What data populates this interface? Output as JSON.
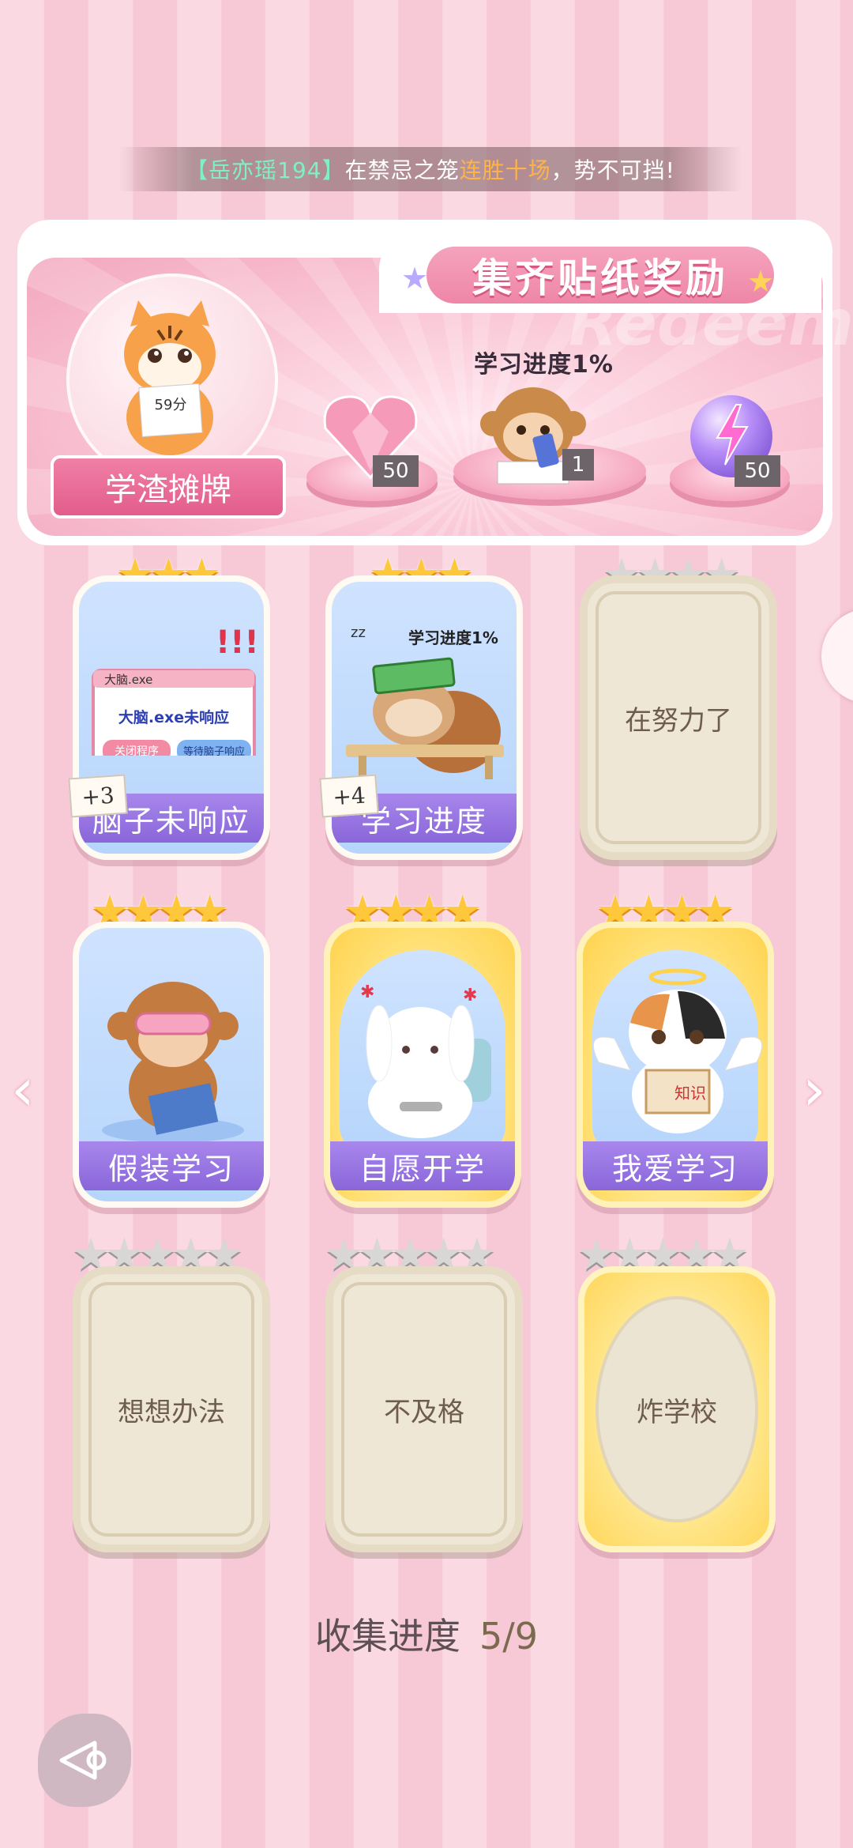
{
  "marquee": {
    "name": "【岳亦瑶194】",
    "text1": "在禁忌之笼",
    "highlight": "连胜十场",
    "text2": "，势不可挡!"
  },
  "banner": {
    "title": "集齐贴纸奖励",
    "watermark": "Redeem",
    "tag": "学渣摊牌",
    "tiger_note": "59分",
    "center_label": "学习进度1%",
    "rewards": [
      {
        "icon": "pink-diamond-heart-icon",
        "qty": "50"
      },
      {
        "icon": "monkey-studying-icon",
        "qty": "1"
      },
      {
        "icon": "purple-lightning-orb-icon",
        "qty": "50"
      }
    ]
  },
  "cards": [
    {
      "label": "脑子未响应",
      "stars": 4,
      "state": "unlocked",
      "extra": "+3",
      "popup_title": "大脑.exe",
      "popup_msg": "大脑.exe未响应",
      "btn1": "关闭程序",
      "btn2": "等待脑子响应"
    },
    {
      "label": "学习进度",
      "stars": 4,
      "state": "unlocked",
      "extra": "+4",
      "note": "学习进度1%",
      "zz": "zz"
    },
    {
      "label": "在努力了",
      "stars": 4,
      "state": "locked"
    },
    {
      "label": "假装学习",
      "stars": 4,
      "state": "unlocked"
    },
    {
      "label": "自愿开学",
      "stars": 4,
      "state": "unlocked-gold"
    },
    {
      "label": "我爱学习",
      "stars": 4,
      "state": "unlocked-gold",
      "book_text": "知识"
    },
    {
      "label": "想想办法",
      "stars": 5,
      "state": "locked"
    },
    {
      "label": "不及格",
      "stars": 5,
      "state": "locked"
    },
    {
      "label": "炸学校",
      "stars": 5,
      "state": "locked-gold"
    }
  ],
  "collection": {
    "label": "收集进度",
    "value": "5/9"
  },
  "nav": {
    "left": "‹",
    "right": "›"
  },
  "colors": {
    "accent_pink": "#ee86a7",
    "label_purple": "#8a66d9",
    "star_gold": "#ffc83a"
  }
}
